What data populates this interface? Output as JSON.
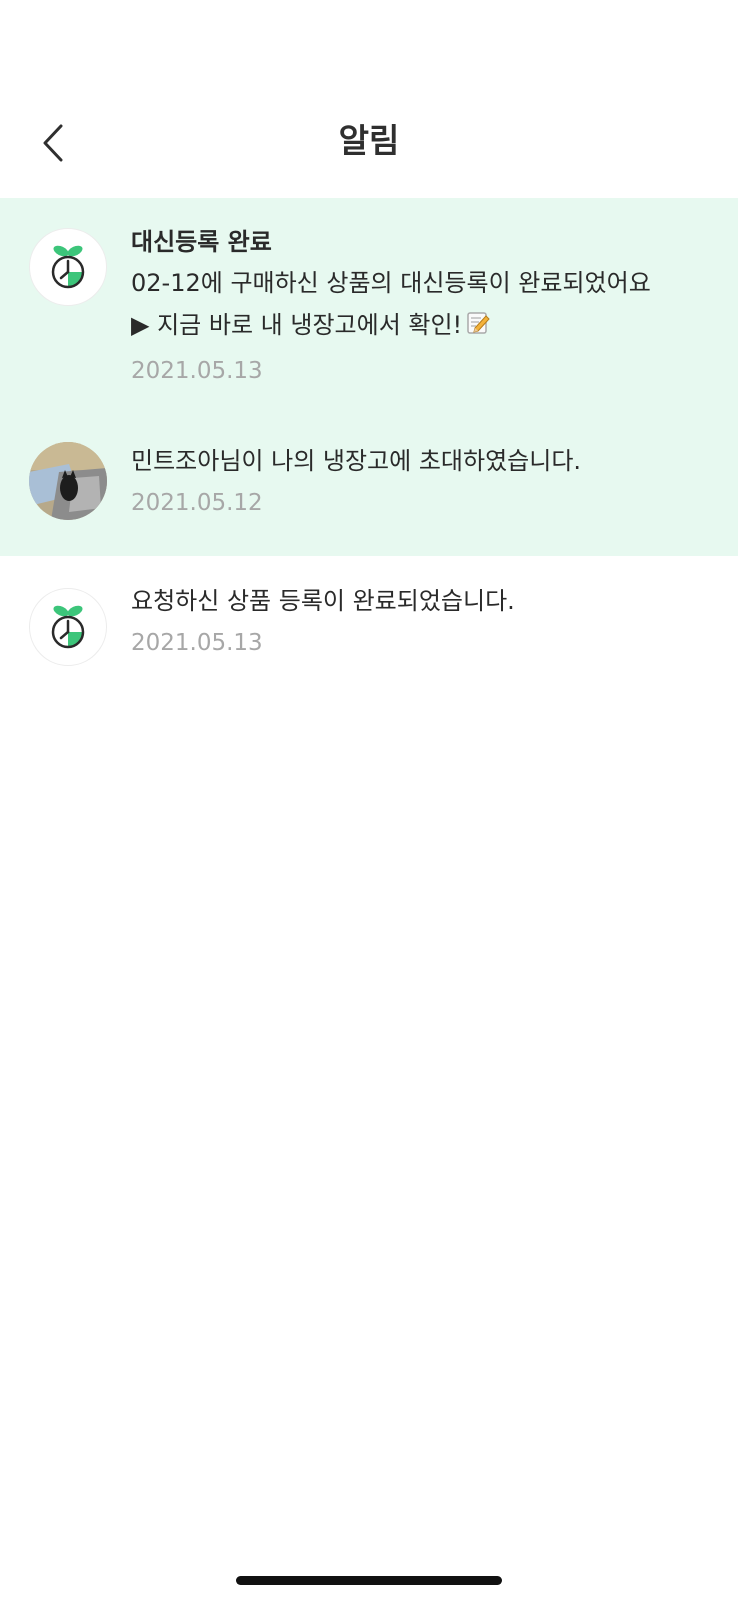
{
  "header": {
    "title": "알림",
    "back_icon": "chevron-left-icon"
  },
  "notifications": [
    {
      "avatar": "app-logo-icon",
      "unread": true,
      "title": "대신등록 완료",
      "message": "02-12에 구매하신 상품의 대신등록이 완료되었어요\n▶ 지금 바로 내 냉장고에서 확인!",
      "message_icon": "memo-pencil-icon",
      "date": "2021.05.13"
    },
    {
      "avatar": "user-photo-avatar",
      "unread": true,
      "message": "민트조아님이 나의 냉장고에 초대하였습니다.",
      "date": "2021.05.12"
    },
    {
      "avatar": "app-logo-icon",
      "unread": false,
      "message": "요청하신 상품 등록이 완료되었습니다.",
      "date": "2021.05.13"
    }
  ],
  "colors": {
    "unread_background": "#e7f9f0",
    "brand_green": "#3cc57a",
    "date_text": "#a7a7a7"
  }
}
